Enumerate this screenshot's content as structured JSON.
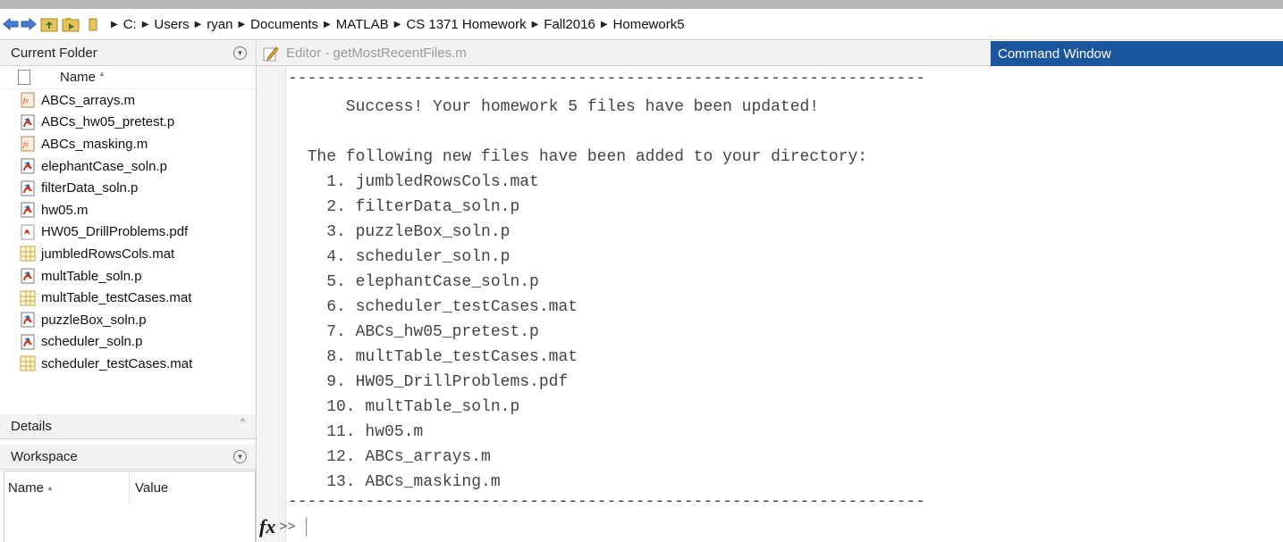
{
  "breadcrumb": [
    "C:",
    "Users",
    "ryan",
    "Documents",
    "MATLAB",
    "CS 1371 Homework",
    "Fall2016",
    "Homework5"
  ],
  "current_folder": {
    "title": "Current Folder",
    "column_name": "Name",
    "files": [
      {
        "name": "ABCs_arrays.m",
        "icon": "m-file-icon"
      },
      {
        "name": "ABCs_hw05_pretest.p",
        "icon": "p-file-icon"
      },
      {
        "name": "ABCs_masking.m",
        "icon": "m-file-icon"
      },
      {
        "name": "elephantCase_soln.p",
        "icon": "p-file-icon"
      },
      {
        "name": "filterData_soln.p",
        "icon": "p-file-icon"
      },
      {
        "name": "hw05.m",
        "icon": "p-file-icon"
      },
      {
        "name": "HW05_DrillProblems.pdf",
        "icon": "pdf-file-icon"
      },
      {
        "name": "jumbledRowsCols.mat",
        "icon": "mat-file-icon"
      },
      {
        "name": "multTable_soln.p",
        "icon": "p-file-icon"
      },
      {
        "name": "multTable_testCases.mat",
        "icon": "mat-file-icon"
      },
      {
        "name": "puzzleBox_soln.p",
        "icon": "p-file-icon"
      },
      {
        "name": "scheduler_soln.p",
        "icon": "p-file-icon"
      },
      {
        "name": "scheduler_testCases.mat",
        "icon": "mat-file-icon"
      }
    ]
  },
  "details": {
    "title": "Details"
  },
  "workspace": {
    "title": "Workspace",
    "col_name": "Name",
    "col_value": "Value"
  },
  "editor": {
    "tab_label": "Editor - getMostRecentFiles.m"
  },
  "command_window": {
    "title": "Command Window",
    "lines": [
      "------------------------------------------------------------------",
      "      Success! Your homework 5 files have been updated!",
      "",
      "  The following new files have been added to your directory:",
      "    1. jumbledRowsCols.mat",
      "    2. filterData_soln.p",
      "    3. puzzleBox_soln.p",
      "    4. scheduler_soln.p",
      "    5. elephantCase_soln.p",
      "    6. scheduler_testCases.mat",
      "    7. ABCs_hw05_pretest.p",
      "    8. multTable_testCases.mat",
      "    9. HW05_DrillProblems.pdf",
      "    10. multTable_soln.p",
      "    11. hw05.m",
      "    12. ABCs_arrays.m",
      "    13. ABCs_masking.m",
      "------------------------------------------------------------------"
    ],
    "fx_label": "fx",
    "prompt": ">>"
  },
  "colors": {
    "command_window_tab": "#1a56a0",
    "panel_header": "#f2f2f2"
  }
}
